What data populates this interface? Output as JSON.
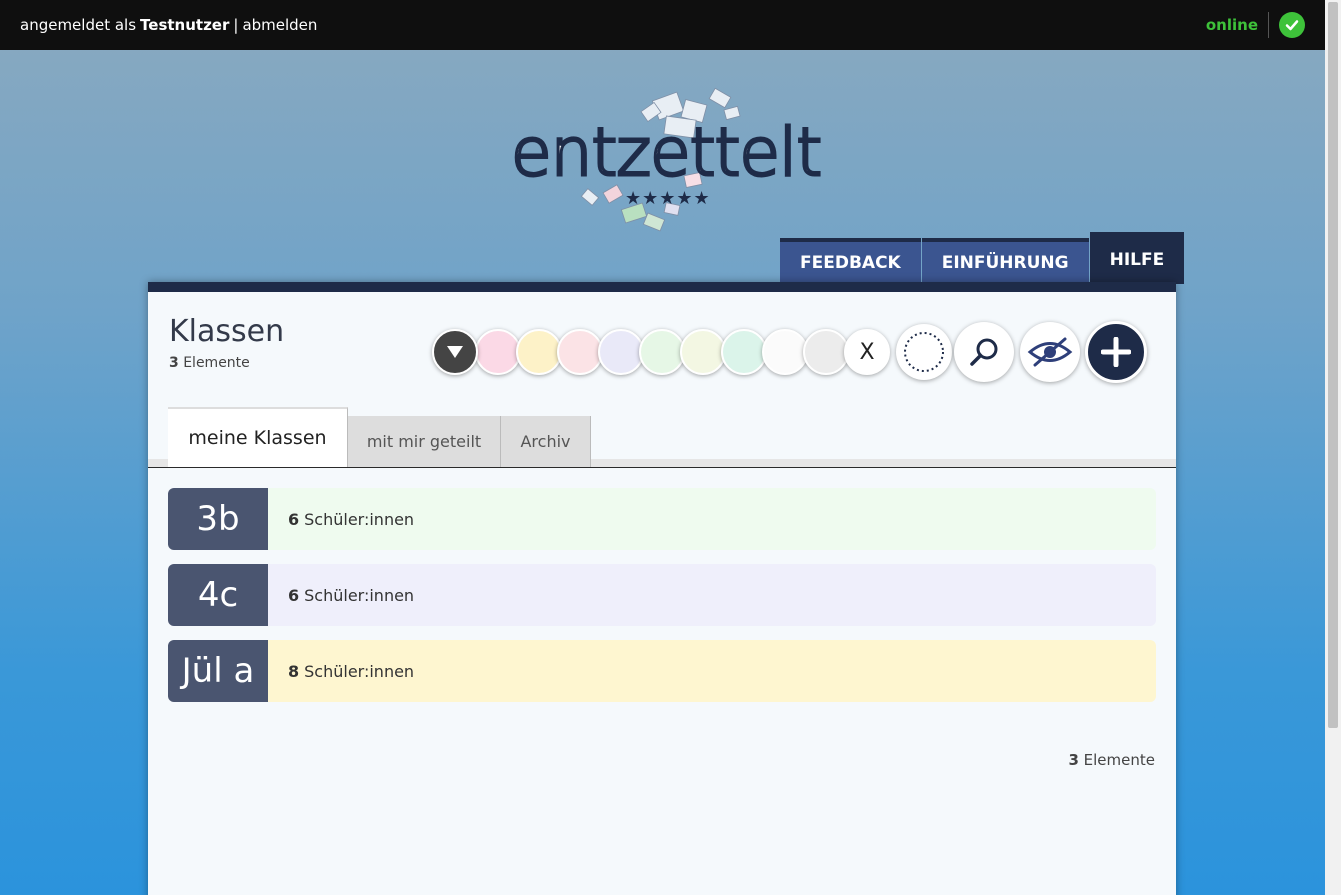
{
  "topbar": {
    "login_prefix": "angemeldet als",
    "username": "Testnutzer",
    "separator": "|",
    "logout": "abmelden",
    "status": "online"
  },
  "logo": {
    "title": "entzettelt",
    "stars": "★★★★★"
  },
  "toptabs": [
    {
      "label": "FEEDBACK"
    },
    {
      "label": "EINFÜHRUNG"
    },
    {
      "label": "HILFE"
    }
  ],
  "page": {
    "title": "Klassen",
    "count": "3",
    "count_label": "Elemente"
  },
  "color_filter": {
    "colors": [
      "#fbd9e6",
      "#fdf2c8",
      "#fbe3e6",
      "#e9e9f8",
      "#e6f7e6",
      "#f3f7e3",
      "#dbf4ea",
      "#fbfbfb",
      "#ececec"
    ],
    "clear_label": "X"
  },
  "listtabs": [
    {
      "label": "meine Klassen"
    },
    {
      "label": "mit mir geteilt"
    },
    {
      "label": "Archiv"
    }
  ],
  "classes": [
    {
      "name": "3b",
      "count": "6",
      "unit": "Schüler:innen",
      "color": "#effbef"
    },
    {
      "name": "4c",
      "count": "6",
      "unit": "Schüler:innen",
      "color": "#efeffb"
    },
    {
      "name": "Jül a",
      "count": "8",
      "unit": "Schüler:innen",
      "color": "#fef6d0"
    }
  ],
  "footer": {
    "count": "3",
    "count_label": "Elemente"
  }
}
